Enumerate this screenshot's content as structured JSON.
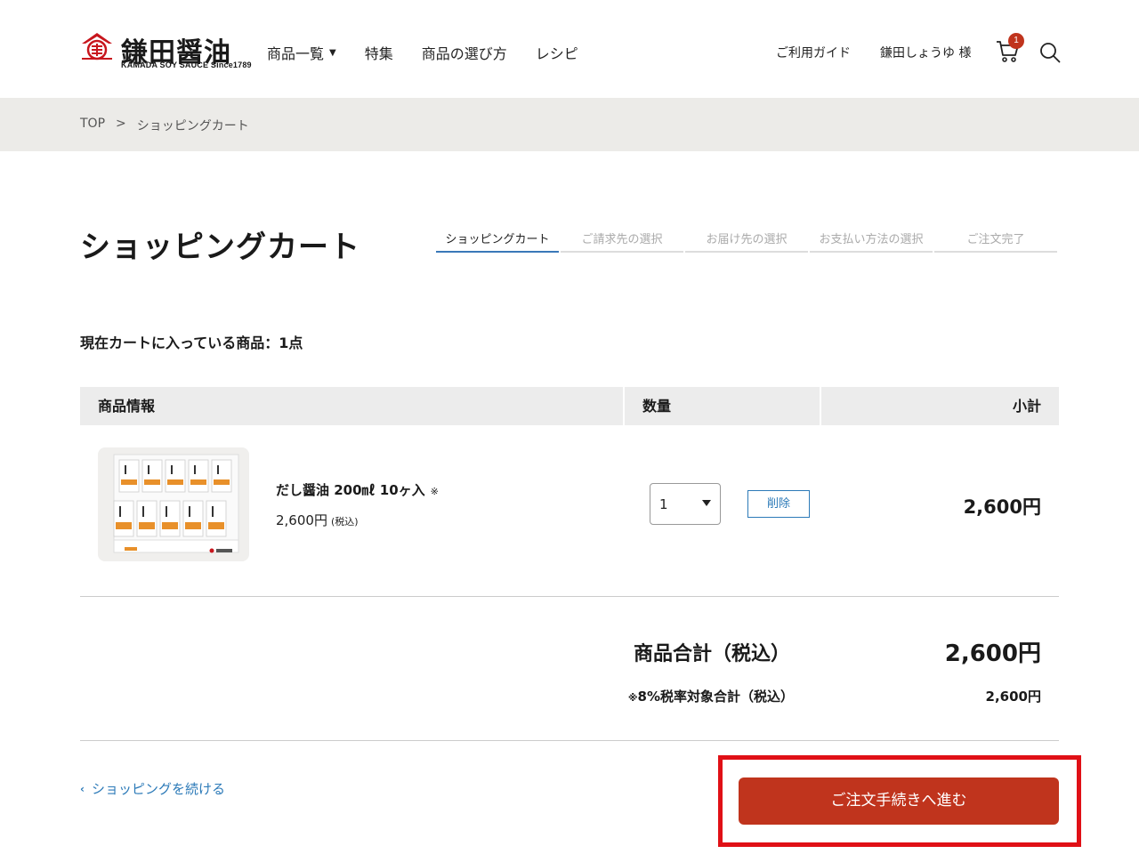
{
  "brand": {
    "name": "鎌田醤油",
    "tagline": "KAMADA SOY SAUCE Since1789",
    "accent_color": "#c0341d"
  },
  "nav": {
    "items": [
      {
        "label": "商品一覧",
        "has_dropdown": true
      },
      {
        "label": "特集"
      },
      {
        "label": "商品の選び方"
      },
      {
        "label": "レシピ"
      }
    ]
  },
  "utility": {
    "guide": "ご利用ガイド",
    "user": "鎌田しょうゆ 様",
    "cart_count": "1",
    "cart_icon": "cart-icon",
    "search_icon": "search-icon"
  },
  "breadcrumb": {
    "items": [
      "TOP",
      "ショッピングカート"
    ],
    "separator": ">"
  },
  "page": {
    "title": "ショッピングカート",
    "steps": [
      "ショッピングカート",
      "ご請求先の選択",
      "お届け先の選択",
      "お支払い方法の選択",
      "ご注文完了"
    ],
    "active_step": 0,
    "count_label": "現在カートに入っている商品：1点"
  },
  "table": {
    "headers": {
      "info": "商品情報",
      "qty": "数量",
      "subtotal": "小計"
    },
    "items": [
      {
        "name": "だし醤油 200㎖ 10ヶ入",
        "note": "※",
        "price": "2,600円",
        "tax_note": "(税込)",
        "quantity": "1",
        "delete_label": "削除",
        "subtotal": "2,600円"
      }
    ]
  },
  "summary": {
    "total_label": "商品合計（税込）",
    "total_value": "2,600円",
    "tax_mark": "※",
    "tax_label": "8%税率対象合計（税込）",
    "tax_value": "2,600円"
  },
  "actions": {
    "continue_label": "ショッピングを続ける",
    "checkout_label": "ご注文手続きへ進む"
  }
}
